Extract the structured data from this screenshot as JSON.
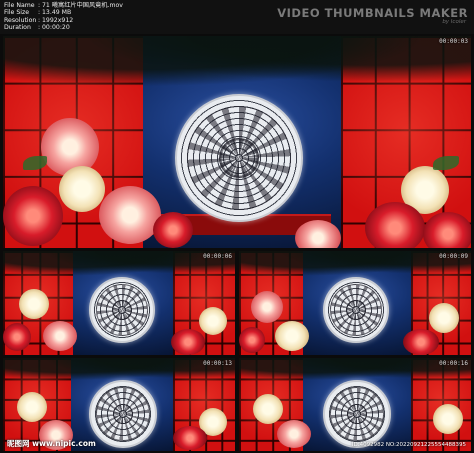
{
  "header": {
    "rows": [
      {
        "label": "File Name",
        "value": "71 曦寓红片中国风竟机.mov"
      },
      {
        "label": "File Size",
        "value": "13.49 MB"
      },
      {
        "label": "Resolution",
        "value": "1992x912"
      },
      {
        "label": "Duration",
        "value": "00:00:20"
      }
    ],
    "brand": "VIDEO THUMBNAILS MAKER",
    "brand_sub": "by Icoler"
  },
  "frames": [
    {
      "timestamp": "00:00:03"
    },
    {
      "timestamp": "00:00:06"
    },
    {
      "timestamp": "00:00:09"
    },
    {
      "timestamp": "00:00:13"
    },
    {
      "timestamp": "00:00:16"
    }
  ],
  "watermark": {
    "left": "昵图网 www.nipic.com",
    "right": "ID:4092982 NO:20220921225554488395"
  },
  "colors": {
    "window_red": "#d11010",
    "sky_blue": "#13306e",
    "background": "#0b0b0b"
  }
}
